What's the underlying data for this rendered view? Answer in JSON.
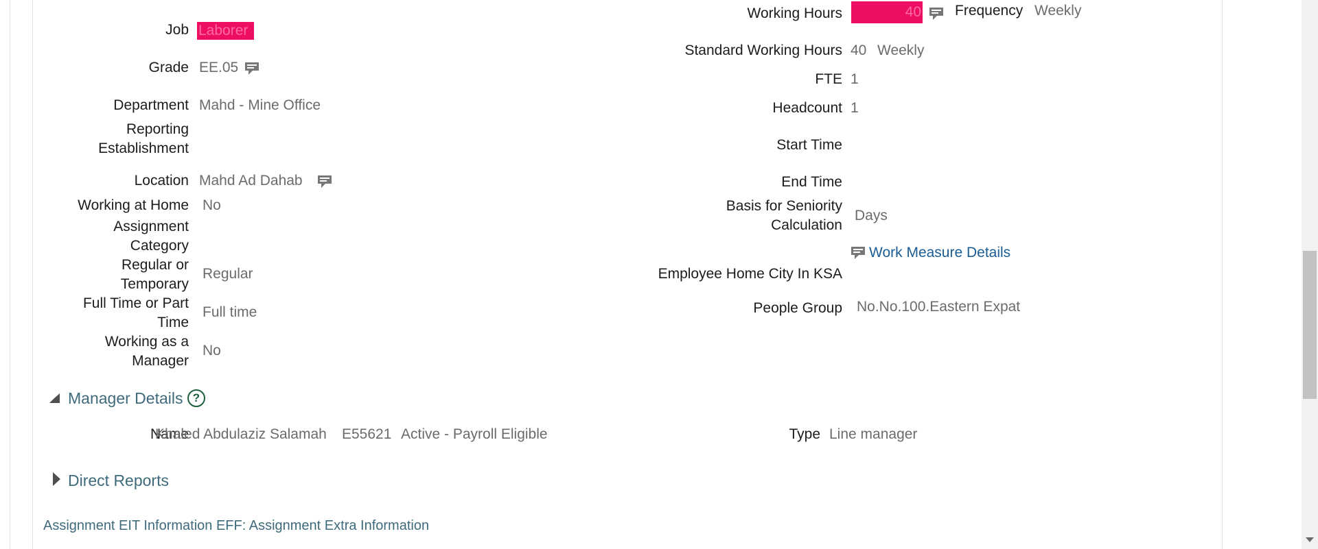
{
  "left": {
    "job_label": "Job",
    "job_value": "Laborer",
    "grade_label": "Grade",
    "grade_value": "EE.05",
    "department_label": "Department",
    "department_value": "Mahd - Mine Office",
    "reporting_label_1": "Reporting",
    "reporting_label_2": "Establishment",
    "location_label": "Location",
    "location_value": "Mahd Ad Dahab",
    "home_label": "Working at Home",
    "home_value": "No",
    "category_label_1": "Assignment",
    "category_label_2": "Category",
    "regular_label_1": "Regular or",
    "regular_label_2": "Temporary",
    "regular_value": "Regular",
    "fulltime_label_1": "Full Time or Part",
    "fulltime_label_2": "Time",
    "fulltime_value": "Full time",
    "manager_label_1": "Working as a",
    "manager_label_2": "Manager",
    "manager_value": "No"
  },
  "right": {
    "working_hours_label": "Working Hours",
    "working_hours_value": "40",
    "frequency_label": "Frequency",
    "frequency_value": "Weekly",
    "std_hours_label": "Standard Working Hours",
    "std_hours_value": "40",
    "std_hours_freq": "Weekly",
    "fte_label": "FTE",
    "fte_value": "1",
    "headcount_label": "Headcount",
    "headcount_value": "1",
    "start_time_label": "Start Time",
    "end_time_label": "End Time",
    "seniority_label_1": "Basis for Seniority",
    "seniority_label_2": "Calculation",
    "seniority_value": "Days",
    "work_measure_link": "Work Measure Details",
    "home_city_label": "Employee Home City In KSA",
    "people_group_label": "People Group",
    "people_group_value": "No.No.100.Eastern Expat"
  },
  "manager_section": {
    "title": "Manager Details",
    "help_glyph": "?",
    "name_label": "Name",
    "name_value": "Khaled Abdulaziz Salamah",
    "employee_id": "E55621",
    "status": "Active - Payroll Eligible",
    "type_label": "Type",
    "type_value": "Line manager"
  },
  "direct_reports": {
    "title": "Direct Reports"
  },
  "footer": {
    "eit_title": "Assignment EIT Information EFF: Assignment Extra Information"
  },
  "icons": {
    "info": "comment-detail-icon",
    "expand": "triangle-down-icon",
    "collapse": "triangle-right-icon",
    "help": "help-circle-icon"
  },
  "colors": {
    "highlight": "#ee0e64",
    "link": "#1a5d94",
    "section": "#3e6a7b",
    "value": "#6b6b6b"
  }
}
